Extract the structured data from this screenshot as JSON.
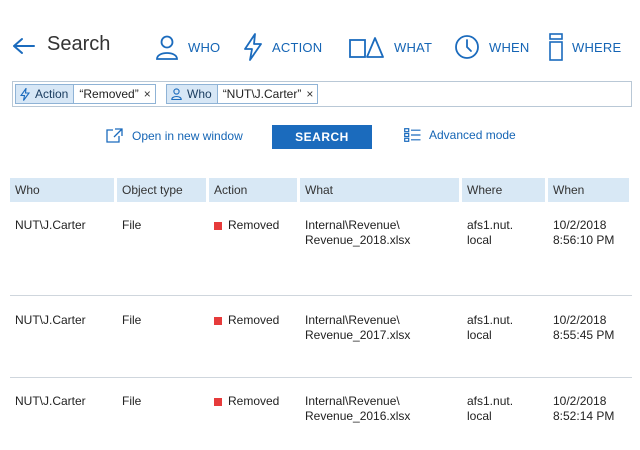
{
  "header": {
    "title": "Search",
    "categories": [
      {
        "label": "WHO",
        "icon": "person-icon"
      },
      {
        "label": "ACTION",
        "icon": "lightning-icon"
      },
      {
        "label": "WHAT",
        "icon": "shapes-icon"
      },
      {
        "label": "WHEN",
        "icon": "clock-icon"
      },
      {
        "label": "WHERE",
        "icon": "server-icon"
      }
    ]
  },
  "search": {
    "filters": [
      {
        "key": "Action",
        "value": "“Removed”",
        "icon": "lightning-icon"
      },
      {
        "key": "Who",
        "value": "“NUT\\J.Carter”",
        "icon": "person-icon"
      }
    ],
    "remove_glyph": "×"
  },
  "actions": {
    "open_new_window": "Open in new window",
    "search_button": "SEARCH",
    "advanced_mode": "Advanced mode"
  },
  "table": {
    "columns": [
      "Who",
      "Object type",
      "Action",
      "What",
      "Where",
      "When"
    ],
    "rows": [
      {
        "who": "NUT\\J.Carter",
        "type": "File",
        "action": "Removed",
        "what1": "Internal\\Revenue\\",
        "what2": "Revenue_2018.xlsx",
        "where1": "afs1.nut.",
        "where2": "local",
        "date": "10/2/2018",
        "time": "8:56:10 PM"
      },
      {
        "who": "NUT\\J.Carter",
        "type": "File",
        "action": "Removed",
        "what1": "Internal\\Revenue\\",
        "what2": "Revenue_2017.xlsx",
        "where1": "afs1.nut.",
        "where2": "local",
        "date": "10/2/2018",
        "time": "8:55:45 PM"
      },
      {
        "who": "NUT\\J.Carter",
        "type": "File",
        "action": "Removed",
        "what1": "Internal\\Revenue\\",
        "what2": "Revenue_2016.xlsx",
        "where1": "afs1.nut.",
        "where2": "local",
        "date": "10/2/2018",
        "time": "8:52:14 PM"
      }
    ]
  },
  "colors": {
    "accent": "#1565b5",
    "button": "#1b6bbd",
    "header_bg": "#d8e8f5",
    "removed": "#e63b3b"
  }
}
